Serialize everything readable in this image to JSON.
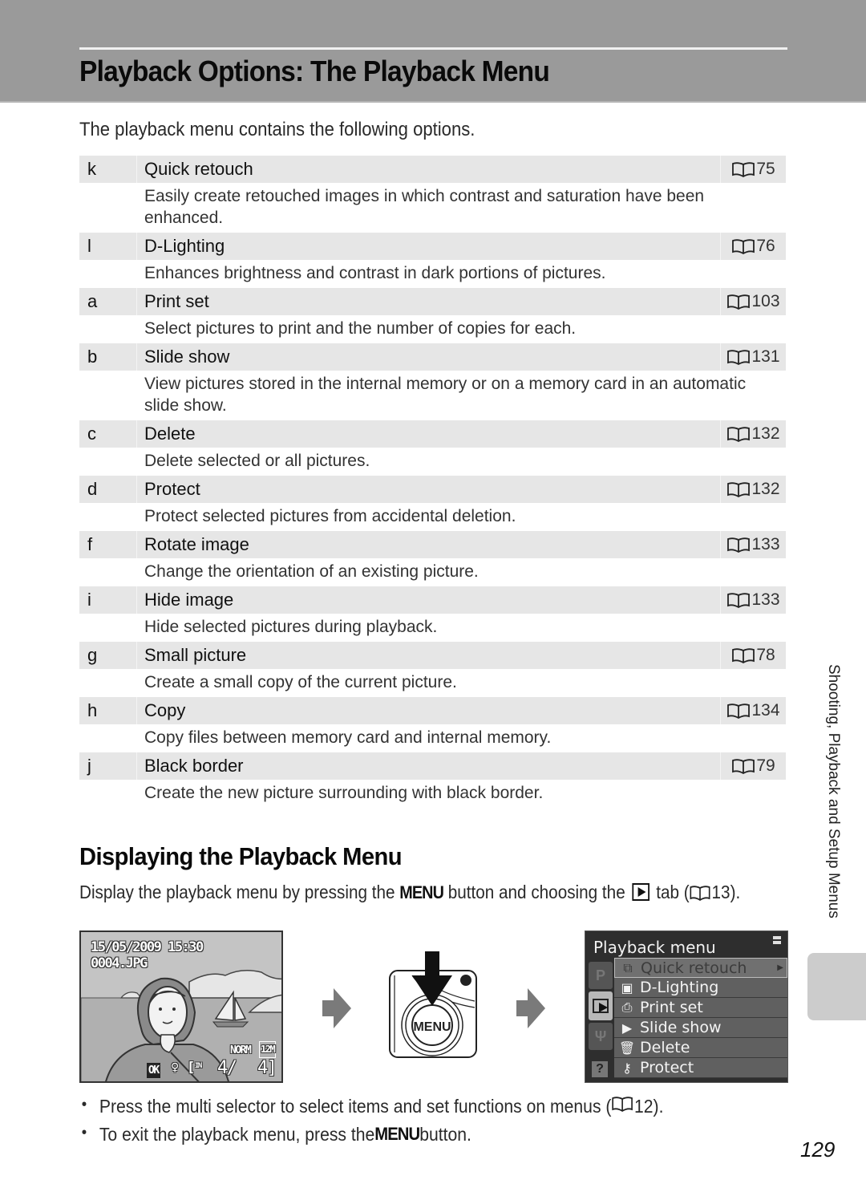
{
  "header": {
    "title": "Playback Options: The Playback Menu"
  },
  "intro": "The playback menu contains the following options.",
  "options": [
    {
      "glyph": "k",
      "name": "Quick retouch",
      "ref": "75",
      "description": "Easily create retouched images in which contrast and saturation have been enhanced."
    },
    {
      "glyph": "l",
      "name": "D-Lighting",
      "ref": "76",
      "description": "Enhances brightness and contrast in dark portions of pictures."
    },
    {
      "glyph": "a",
      "name": "Print set",
      "ref": "103",
      "description": "Select pictures to print and the number of copies for each."
    },
    {
      "glyph": "b",
      "name": "Slide show",
      "ref": "131",
      "description": "View pictures stored in the internal memory or on a memory card in an automatic slide show."
    },
    {
      "glyph": "c",
      "name": "Delete",
      "ref": "132",
      "description": "Delete selected or all pictures."
    },
    {
      "glyph": "d",
      "name": "Protect",
      "ref": "132",
      "description": "Protect selected pictures from accidental deletion."
    },
    {
      "glyph": "f",
      "name": "Rotate image",
      "ref": "133",
      "description": "Change the orientation of an existing picture."
    },
    {
      "glyph": "i",
      "name": "Hide image",
      "ref": "133",
      "description": "Hide selected pictures during playback."
    },
    {
      "glyph": "g",
      "name": "Small picture",
      "ref": "78",
      "description": "Create a small copy of the current picture."
    },
    {
      "glyph": "h",
      "name": "Copy",
      "ref": "134",
      "description": "Copy files between memory card and internal memory."
    },
    {
      "glyph": "j",
      "name": "Black border",
      "ref": "79",
      "description": "Create the new picture surrounding with black border."
    }
  ],
  "section": {
    "title": "Displaying the Playback Menu",
    "text_1": "Display the playback menu by pressing the ",
    "menu_word": "MENU",
    "text_2": " button and choosing the ",
    "text_3": " tab (",
    "ref": "13",
    "text_4": ")."
  },
  "lcd": {
    "datetime": "15/05/2009 15:30",
    "filename": "0004.JPG",
    "quality": "NORM",
    "size": "12M",
    "ok": "OK",
    "memory": "IN",
    "frame": "4/",
    "total": "4]"
  },
  "camera_button": {
    "label": "MENU"
  },
  "camera_menu": {
    "title": "Playback menu",
    "tabs": [
      "P",
      "play",
      "setup"
    ],
    "help": "?",
    "items": [
      {
        "icon": "quick-retouch-icon",
        "label": "Quick retouch",
        "selected": true
      },
      {
        "icon": "d-lighting-icon",
        "label": "D-Lighting"
      },
      {
        "icon": "print-set-icon",
        "label": "Print set"
      },
      {
        "icon": "slide-show-icon",
        "label": "Slide show"
      },
      {
        "icon": "delete-icon",
        "label": "Delete"
      },
      {
        "icon": "protect-icon",
        "label": "Protect"
      }
    ]
  },
  "bullets": [
    {
      "text": "Press the multi selector to select items and set functions on menus (",
      "ref": "12",
      "after": ")."
    },
    {
      "text": "To exit the playback menu, press the ",
      "menu_word": "MENU",
      "after": " button."
    }
  ],
  "side_tab": {
    "label": "Shooting, Playback and Setup Menus"
  },
  "page_number": "129"
}
